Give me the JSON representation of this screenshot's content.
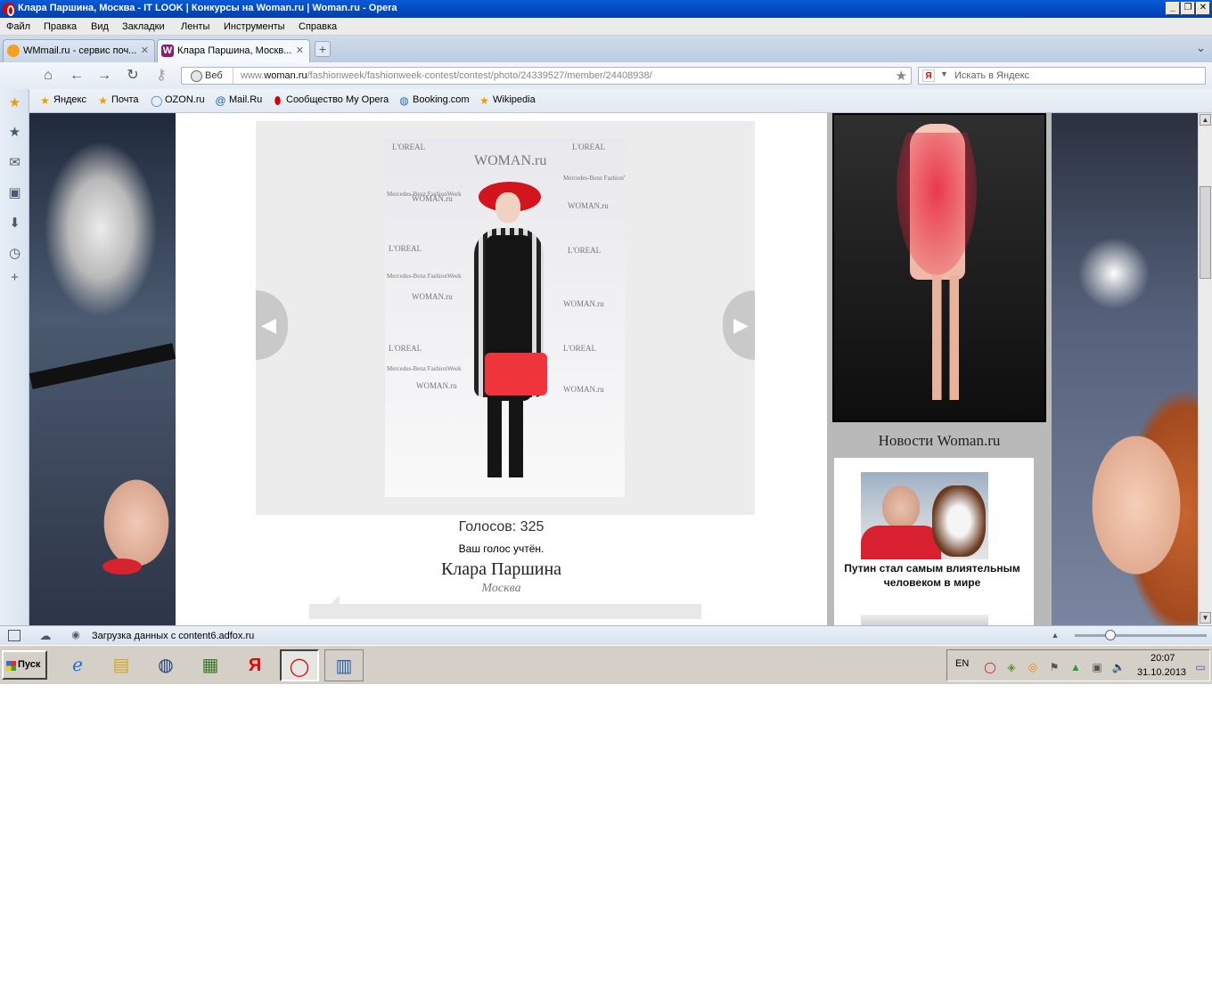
{
  "window": {
    "title": "Клара Паршина, Москва - IT LOOK | Конкурсы на Woman.ru | Woman.ru - Opera",
    "btn_minimize": "_",
    "btn_restore": "❐",
    "btn_close": "✕"
  },
  "menu": [
    "Файл",
    "Правка",
    "Вид",
    "Закладки",
    "Ленты",
    "Инструменты",
    "Справка"
  ],
  "tabs": [
    {
      "label": "WMmail.ru - сервис поч...",
      "close": "✕"
    },
    {
      "label": "Клара Паршина, Москв...",
      "close": "✕"
    }
  ],
  "new_tab": "+",
  "tab_menu": "⌄",
  "address": {
    "web_label": "Веб",
    "url_prefix": "www.",
    "url_domain": "woman.ru",
    "url_path": "/fashionweek/fashionweek-contest/contest/photo/24339527/member/24408938/"
  },
  "search": {
    "placeholder": "Искать в Яндекс",
    "engine_glyph": "Я"
  },
  "bookmarks": [
    {
      "label": "Яндекс",
      "icon": "star-icon"
    },
    {
      "label": "Почта",
      "icon": "star-icon"
    },
    {
      "label": "OZON.ru",
      "icon": "ozon-icon"
    },
    {
      "label": "Mail.Ru",
      "icon": "mailru-icon"
    },
    {
      "label": "Сообщество My Opera",
      "icon": "opera-icon"
    },
    {
      "label": "Booking.com",
      "icon": "globe-icon"
    },
    {
      "label": "Wikipedia",
      "icon": "star-icon"
    }
  ],
  "content": {
    "votes": "Голосов: 325",
    "voted_msg": "Ваш голос учтён.",
    "participant_name": "Клара Паршина",
    "participant_city": "Москва",
    "photo_watermarks": [
      "L'OREAL",
      "WOMAN.ru",
      "Mercedes-Benz FashionWeek"
    ]
  },
  "sidebar_ad": {
    "news_title": "Новости Woman.ru",
    "news_item": "Путин стал самым влиятельным человеком в мире"
  },
  "status": {
    "text": "Загрузка данных с content6.adfox.ru",
    "zoom_level": 0.25
  },
  "taskbar": {
    "start_label": "Пуск",
    "lang": "EN",
    "time": "20:07",
    "date": "31.10.2013"
  }
}
